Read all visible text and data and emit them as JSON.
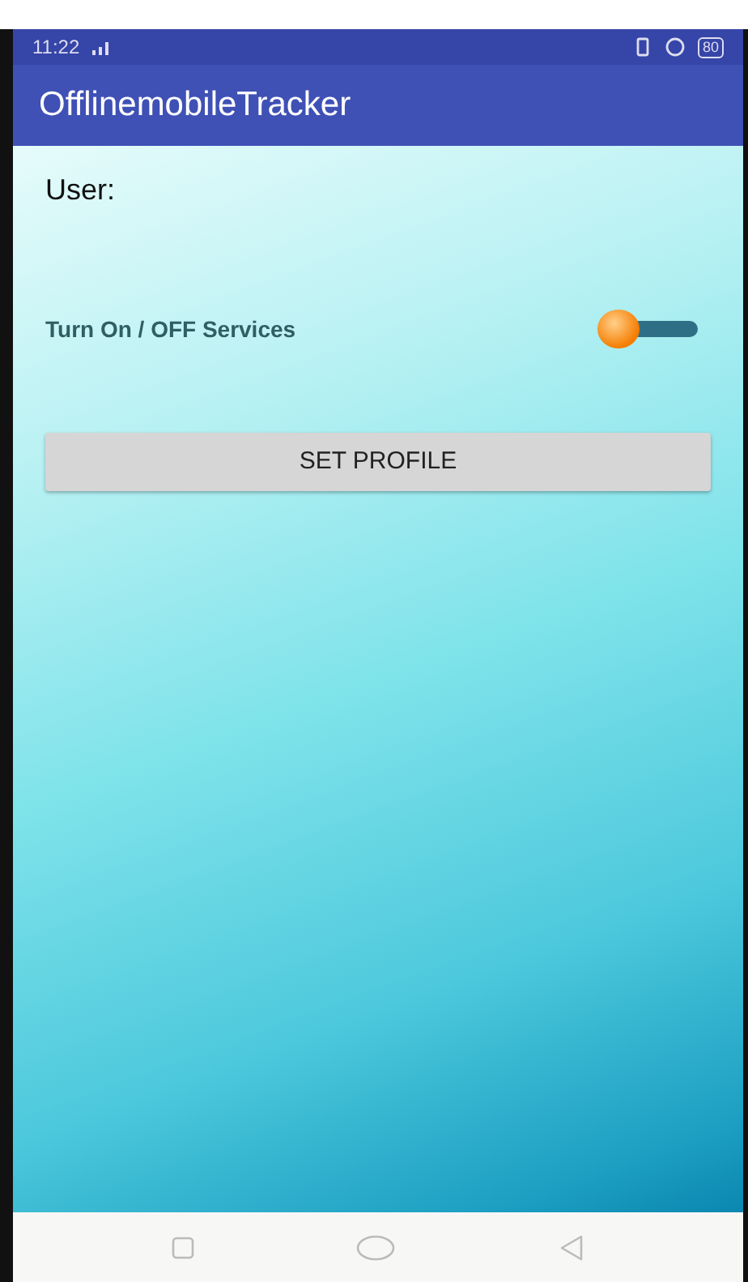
{
  "status_bar": {
    "time": "11:22",
    "battery": "80"
  },
  "app_bar": {
    "title": "OfflinemobileTracker"
  },
  "user_label": "User:",
  "service_switch": {
    "label": "Turn On / OFF Services",
    "on": false
  },
  "set_profile_button": "SET PROFILE"
}
